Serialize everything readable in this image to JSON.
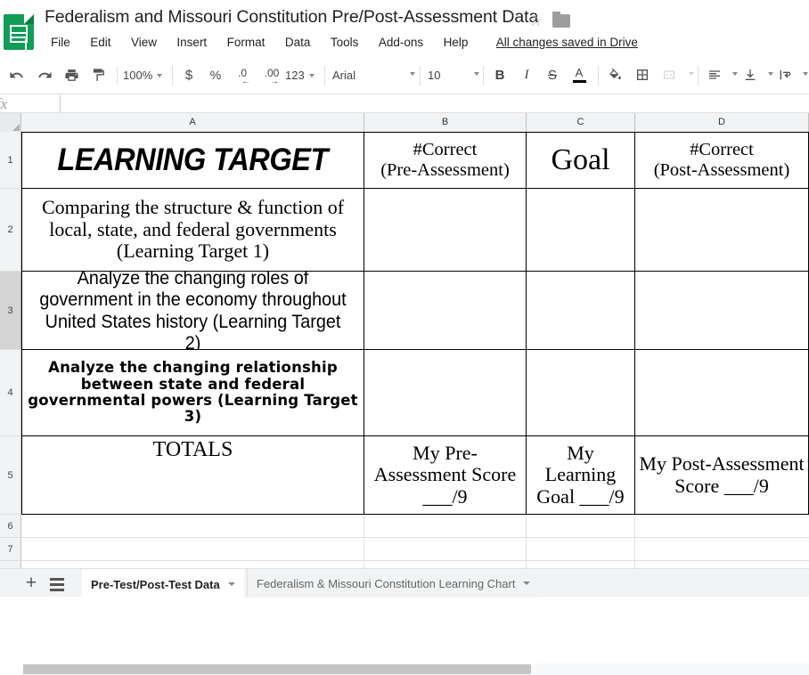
{
  "titlebar": {
    "doc_title": "Federalism and Missouri Constitution Pre/Post-Assessment Data",
    "star_glyph": "☆",
    "menus": [
      "File",
      "Edit",
      "View",
      "Insert",
      "Format",
      "Data",
      "Tools",
      "Add-ons",
      "Help"
    ],
    "save_status": "All changes saved in Drive"
  },
  "toolbar": {
    "undo": "↶",
    "redo": "↷",
    "zoom_value": "100%",
    "currency": "$",
    "percent": "%",
    "decimal_decrease": ".0",
    "decimal_increase": ".00",
    "number_format": "123",
    "font_family_value": "Arial",
    "font_size_value": "10",
    "bold": "B",
    "italic": "I",
    "strikethrough": "S",
    "text_color": "A",
    "text_color_swatch": "#000000"
  },
  "formulabar": {
    "name_box_value": "",
    "fx_label": "fx",
    "formula_value": ""
  },
  "grid": {
    "columns": [
      "A",
      "B",
      "C",
      "D"
    ],
    "rows": [
      "1",
      "2",
      "3",
      "4",
      "5",
      "6",
      "7"
    ],
    "selected_row": "3",
    "table": {
      "header": {
        "a": "LEARNING TARGET",
        "b": "#Correct\n(Pre-Assessment)",
        "b_line1": "#Correct",
        "b_line2": "(Pre-Assessment)",
        "c": "Goal",
        "d_line1": "#Correct",
        "d_line2": "(Post-Assessment)"
      },
      "rows": [
        {
          "target": "Comparing the structure & function of local, state, and federal governments (Learning Target 1)",
          "pre": "",
          "goal": "",
          "post": ""
        },
        {
          "target": "Analyze the changing roles of government in the economy throughout United States history (Learning Target 2)",
          "pre": "",
          "goal": "",
          "post": ""
        },
        {
          "target": "Analyze the changing relationship between state and federal governmental powers (Learning Target 3)",
          "pre": "",
          "goal": "",
          "post": ""
        }
      ],
      "totals": {
        "label": "TOTALS",
        "pre": "My Pre-Assessment Score ___/9",
        "goal": "My Learning Goal ___/9",
        "post": "My Post-Assessment Score ___/9"
      }
    }
  },
  "sheetbar": {
    "add_label": "+",
    "tabs": [
      {
        "name": "Pre-Test/Post-Test Data",
        "active": true
      },
      {
        "name": "Federalism & Missouri Constitution Learning Chart",
        "active": false
      }
    ]
  }
}
